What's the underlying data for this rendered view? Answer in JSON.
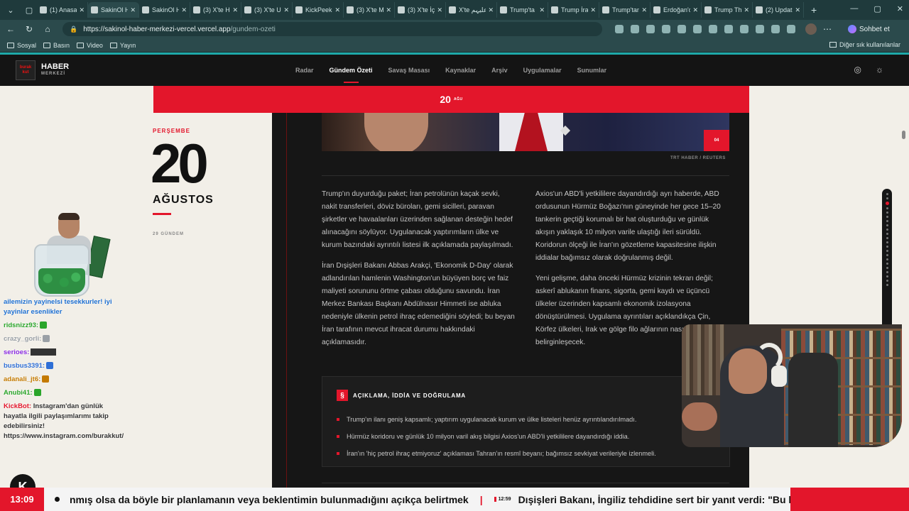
{
  "browser": {
    "tabs": [
      {
        "label": "(1) Anasa",
        "icon": "x-logo-icon"
      },
      {
        "label": "SakinOl H",
        "icon": "site-icon",
        "active": true
      },
      {
        "label": "SakinOl H",
        "icon": "site-icon"
      },
      {
        "label": "(3) X'te H",
        "icon": "x-logo-icon"
      },
      {
        "label": "(3) X'te U",
        "icon": "x-logo-icon"
      },
      {
        "label": "KickPeek",
        "icon": "kick-icon"
      },
      {
        "label": "(3) X'te M",
        "icon": "x-logo-icon"
      },
      {
        "label": "(3) X'te İç",
        "icon": "x-logo-icon"
      },
      {
        "label": "X'te علیہم",
        "icon": "x-logo-icon"
      },
      {
        "label": "Trump'ta",
        "icon": "news-icon"
      },
      {
        "label": "Trump İra",
        "icon": "globe-icon"
      },
      {
        "label": "Trump'tan",
        "icon": "news-icon"
      },
      {
        "label": "Erdoğan'd",
        "icon": "news-icon"
      },
      {
        "label": "Trump Th",
        "icon": "news-icon"
      },
      {
        "label": "(2) Updat",
        "icon": "news-icon"
      }
    ],
    "url_host": "https://sakinol-haber-merkezi-vercel.vercel.app",
    "url_path": "/gundem-ozeti",
    "chat_button": "Sohbet et",
    "bookmarks": [
      "Sosyal",
      "Basın",
      "Video",
      "Yayın"
    ],
    "other_bookmarks": "Diğer sık kullanılanlar"
  },
  "site": {
    "logo_text": "HABER",
    "logo_sub": "MERKEZİ",
    "nav": [
      {
        "label": "Radar"
      },
      {
        "label": "Gündem Özeti",
        "active": true
      },
      {
        "label": "Savaş Masası"
      },
      {
        "label": "Kaynaklar"
      },
      {
        "label": "Arşiv"
      },
      {
        "label": "Uygulamalar"
      },
      {
        "label": "Sunumlar"
      }
    ]
  },
  "date_band": {
    "day": "20",
    "month": "AĞU"
  },
  "dateblock": {
    "weekday": "PERŞEMBE",
    "day": "20",
    "month": "AĞUSTOS",
    "count": "29 GÜNDEM"
  },
  "photo": {
    "counter": "04",
    "credit": "TRT HABER / REUTERS"
  },
  "article": {
    "col1": [
      "Trump'ın duyurduğu paket; İran petrolünün kaçak sevki, nakit transferleri, döviz büroları, gemi sicilleri, paravan şirketler ve havaalanları üzerinden sağlanan desteğin hedef alınacağını söylüyor. Uygulanacak yaptırımların ülke ve kurum bazındaki ayrıntılı listesi ilk açıklamada paylaşılmadı.",
      "İran Dışişleri Bakanı Abbas Arakçi, 'Ekonomik D-Day' olarak adlandırılan hamlenin Washington'un büyüyen borç ve faiz maliyeti sorununu örtme çabası olduğunu savundu. İran Merkez Bankası Başkanı Abdülnasır Himmeti ise abluka nedeniyle ülkenin petrol ihraç edemediğini söyledi; bu beyan İran tarafının mevcut ihracat durumu hakkındaki açıklamasıdır."
    ],
    "col2": [
      "Axios'un ABD'li yetkililere dayandırdığı ayrı haberde, ABD ordusunun Hürmüz Boğazı'nın güneyinde her gece 15–20 tankerin geçtiği korumalı bir hat oluşturduğu ve günlük akışın yaklaşık 10 milyon varile ulaştığı ileri sürüldü. Koridorun ölçeği ile İran'ın gözetleme kapasitesine ilişkin iddialar bağımsız olarak doğrulanmış değil.",
      "Yeni gelişme, daha önceki Hürmüz krizinin tekrarı değil; askerî ablukanın finans, sigorta, gemi kaydı ve üçüncü ülkeler üzerinden kapsamlı ekonomik izolasyona dönüştürülmesi. Uygulama ayrıntıları açıklandıkça Çin, Körfez ülkeleri, Irak ve gölge filo ağlarının nası etkileneceği belirginleşecek."
    ]
  },
  "factbox": {
    "icon": "§",
    "title": "AÇIKLAMA, İDDİA VE DOĞRULAMA",
    "items": [
      "Trump'ın ilanı geniş kapsamlı; yaptırım uygulanacak kurum ve ülke listeleri henüz ayrıntılandırılmadı.",
      "Hürmüz koridoru ve günlük 10 milyon varil akış bilgisi Axios'un ABD'li yetkililere dayandırdığı iddia.",
      "İran'ın 'hiç petrol ihraç etmiyoruz' açıklaması Tahran'ın resmî beyanı; bağımsız sevkiyat verileriyle izlenmeli."
    ]
  },
  "stream_chat": [
    {
      "user": "",
      "text": "ailemizin yayinelsi tesekkurler! iyi yayinlar esenlikler",
      "color": "#1d6fd1"
    },
    {
      "user": "ridsnizz93:",
      "text": "",
      "color": "#2aa52a"
    },
    {
      "user": "crazy_gorli:",
      "text": "",
      "color": "#9aa0a6"
    },
    {
      "user": "serioes:",
      "text": "",
      "color": "#8a2be2"
    },
    {
      "user": "busbus3391:",
      "text": "",
      "color": "#2f6fd6"
    },
    {
      "user": "adanali_jt6:",
      "text": "",
      "color": "#c47a00"
    },
    {
      "user": "Anubi41:",
      "text": "",
      "color": "#2aa52a"
    },
    {
      "user": "KickBot:",
      "text": "Instagram'dan günlük hayatla ilgili paylaşımlarımı takip edebilirsiniz! https://www.instagram.com/burakkut/",
      "color": "#e3162b"
    }
  ],
  "ticker": {
    "time": "13:09",
    "text1": "nmış olsa da böyle bir planlamanın veya beklentimin bulunmadığını açıkça belirtmek",
    "sep": "|",
    "stamp": "12:59",
    "text2": "Dışişleri Bakanı, İngiliz tehdidine sert bir yanıt verdi: \"Bu kibir"
  },
  "colors": {
    "accent": "#e3162b",
    "dark_bg": "#161616",
    "paper": "#f2efe8"
  }
}
